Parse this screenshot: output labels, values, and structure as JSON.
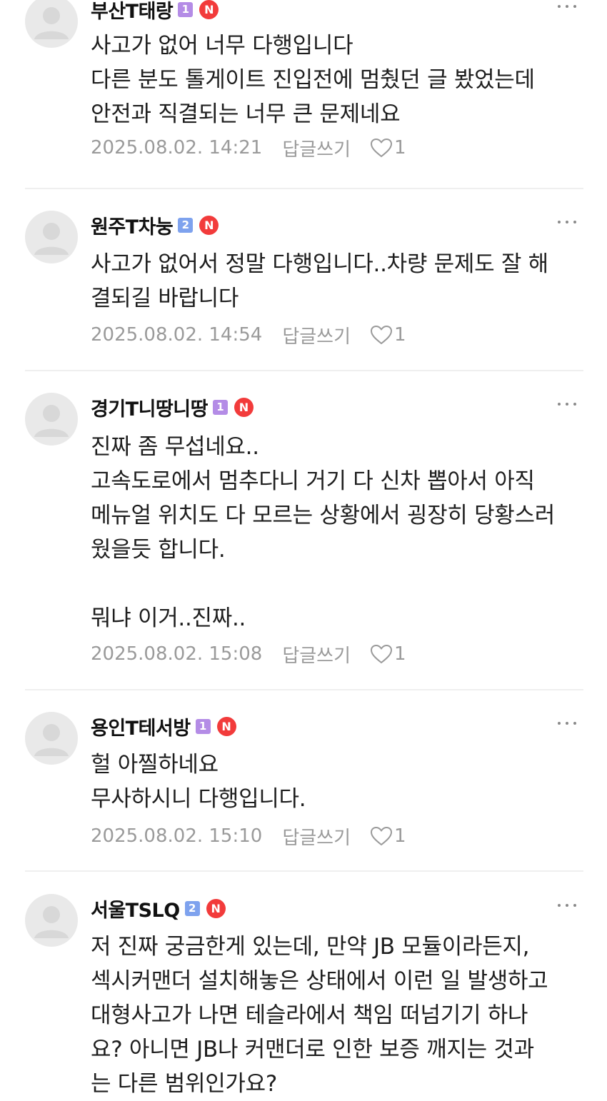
{
  "colors": {
    "level1": "#b48ce6",
    "level2": "#7ea2ee",
    "n_badge": "#f23b3b"
  },
  "icons": {
    "avatar": "default-user-avatar-icon",
    "more": "more-horizontal-icon",
    "like": "heart-outline-icon"
  },
  "comments": [
    {
      "author": "부산T태랑",
      "level": "1",
      "n_badge": "N",
      "text": "사고가 없어 너무 다행입니다\n다른 분도 톨게이트 진입전에 멈췄던 글 봤었는데\n안전과 직결되는 너무 큰 문제네요",
      "timestamp": "2025.08.02. 14:21",
      "reply_label": "답글쓰기",
      "likes": "1"
    },
    {
      "author": "원주T차눙",
      "level": "2",
      "n_badge": "N",
      "text": "사고가 없어서 정말 다행입니다..차량 문제도 잘 해\n결되길 바랍니다",
      "timestamp": "2025.08.02. 14:54",
      "reply_label": "답글쓰기",
      "likes": "1"
    },
    {
      "author": "경기T니땅니땅",
      "level": "1",
      "n_badge": "N",
      "text": "진짜 좀 무섭네요..\n고속도로에서 멈추다니 거기 다 신차 뽑아서 아직\n메뉴얼 위치도 다 모르는 상황에서 굉장히 당황스러\n웠을듯 합니다.\n\n뭐냐 이거..진짜..",
      "timestamp": "2025.08.02. 15:08",
      "reply_label": "답글쓰기",
      "likes": "1"
    },
    {
      "author": "용인T테서방",
      "level": "1",
      "n_badge": "N",
      "text": "헐 아찔하네요\n무사하시니 다행입니다.",
      "timestamp": "2025.08.02. 15:10",
      "reply_label": "답글쓰기",
      "likes": "1"
    },
    {
      "author": "서울TSLQ",
      "level": "2",
      "n_badge": "N",
      "text": "저 진짜 궁금한게 있는데, 만약 JB 모듈이라든지,\n섹시커맨더 설치해놓은 상태에서 이런 일 발생하고\n대형사고가 나면 테슬라에서 책임 떠넘기기 하나\n요? 아니면 JB나 커맨더로 인한 보증 깨지는 것과\n는 다른 범위인가요?"
    }
  ]
}
